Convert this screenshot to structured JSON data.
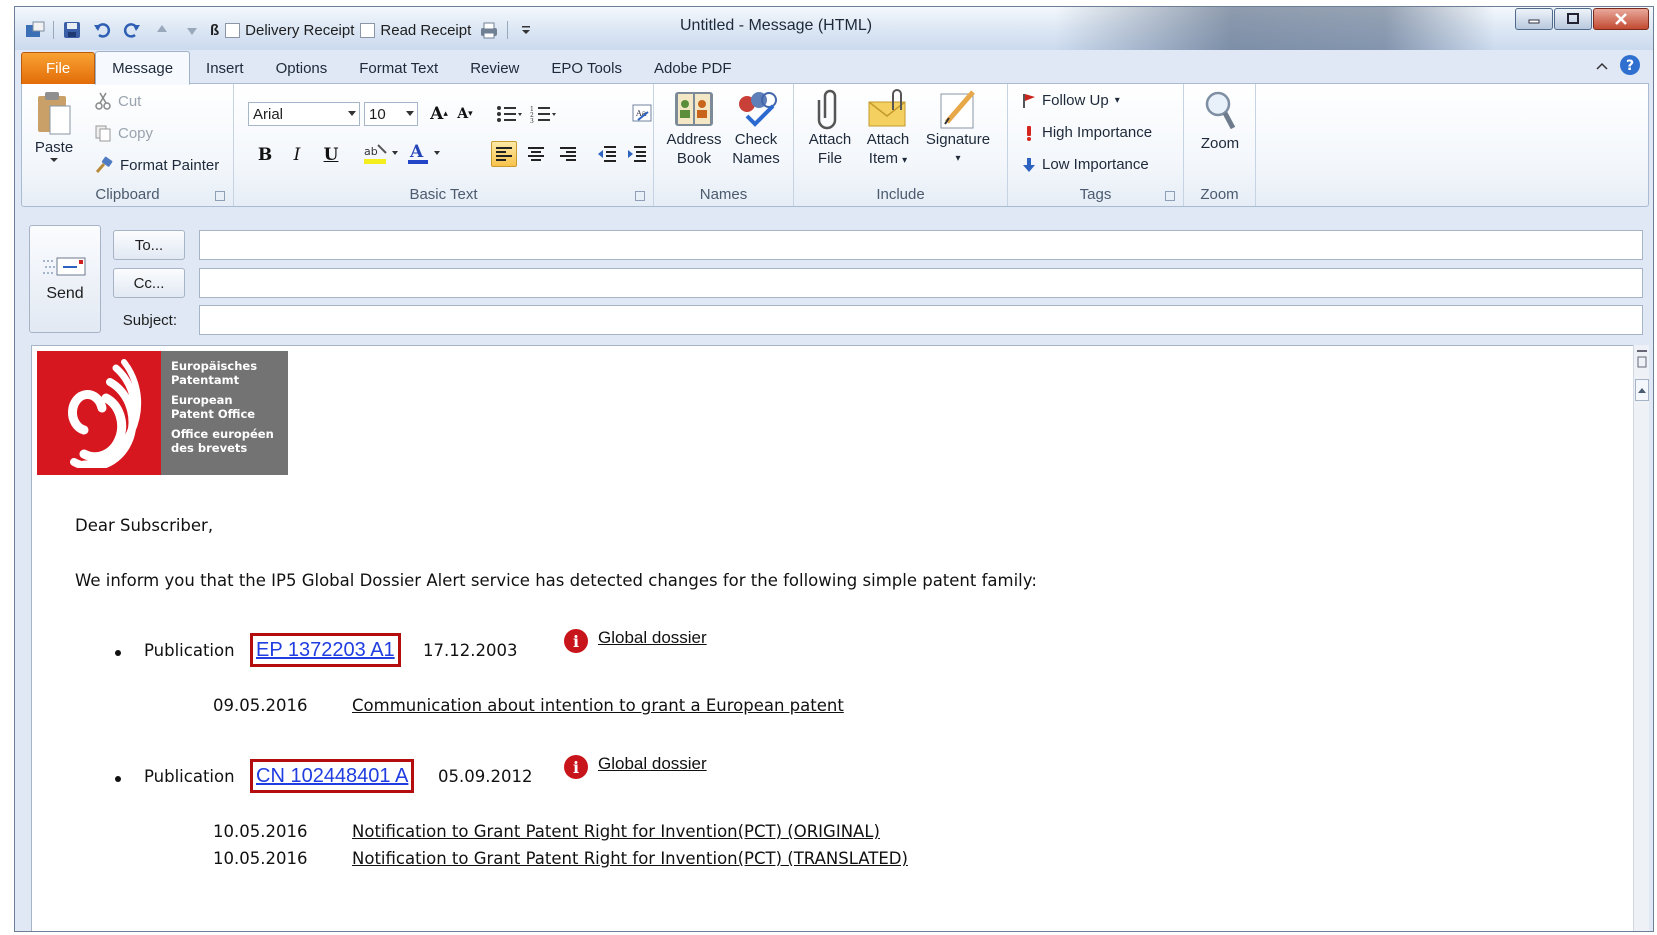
{
  "window": {
    "title": "Untitled - Message (HTML)",
    "qat": {
      "delivery_receipt_label": "Delivery Receipt",
      "read_receipt_label": "Read Receipt",
      "spellcheck_glyph": "ß"
    }
  },
  "tabs": [
    {
      "label": "File"
    },
    {
      "label": "Message"
    },
    {
      "label": "Insert"
    },
    {
      "label": "Options"
    },
    {
      "label": "Format Text"
    },
    {
      "label": "Review"
    },
    {
      "label": "EPO Tools"
    },
    {
      "label": "Adobe PDF"
    }
  ],
  "ribbon": {
    "clipboard": {
      "label": "Clipboard",
      "paste": "Paste",
      "cut": "Cut",
      "copy": "Copy",
      "format_painter": "Format Painter"
    },
    "basic_text": {
      "label": "Basic Text",
      "font": "Arial",
      "size": "10",
      "bold": "B",
      "italic": "I",
      "underline": "U"
    },
    "names": {
      "label": "Names",
      "address_book_1": "Address",
      "address_book_2": "Book",
      "check_names_1": "Check",
      "check_names_2": "Names"
    },
    "include": {
      "label": "Include",
      "attach_file_1": "Attach",
      "attach_file_2": "File",
      "attach_item_1": "Attach",
      "attach_item_2": "Item",
      "signature": "Signature"
    },
    "tags": {
      "label": "Tags",
      "follow_up": "Follow Up",
      "high_importance": "High Importance",
      "low_importance": "Low Importance"
    },
    "zoom": {
      "label": "Zoom",
      "button": "Zoom"
    }
  },
  "header": {
    "send": "Send",
    "to_button": "To...",
    "cc_button": "Cc...",
    "subject_label": "Subject:",
    "to_value": "",
    "cc_value": "",
    "subject_value": ""
  },
  "logo": {
    "lines_de": [
      "Europäisches",
      "Patentamt"
    ],
    "lines_en": [
      "European",
      "Patent Office"
    ],
    "lines_fr": [
      "Office européen",
      "des brevets"
    ]
  },
  "body": {
    "greeting": "Dear Subscriber,",
    "intro": "We inform you that the IP5 Global Dossier Alert service has detected changes for the following simple patent family:",
    "publications": [
      {
        "prefix": "Publication",
        "number": "EP 1372203 A1",
        "date": "17.12.2003",
        "dossier_link": "Global dossier",
        "events": [
          {
            "date": "09.05.2016",
            "text": "Communication about intention to grant a European patent"
          }
        ]
      },
      {
        "prefix": "Publication",
        "number": "CN 102448401 A",
        "date": "05.09.2012",
        "dossier_link": "Global dossier",
        "events": [
          {
            "date": "10.05.2016",
            "text": "Notification to Grant Patent Right for Invention(PCT) (ORIGINAL)"
          },
          {
            "date": "10.05.2016",
            "text": "Notification to Grant Patent Right for Invention(PCT) (TRANSLATED)"
          }
        ]
      }
    ]
  }
}
